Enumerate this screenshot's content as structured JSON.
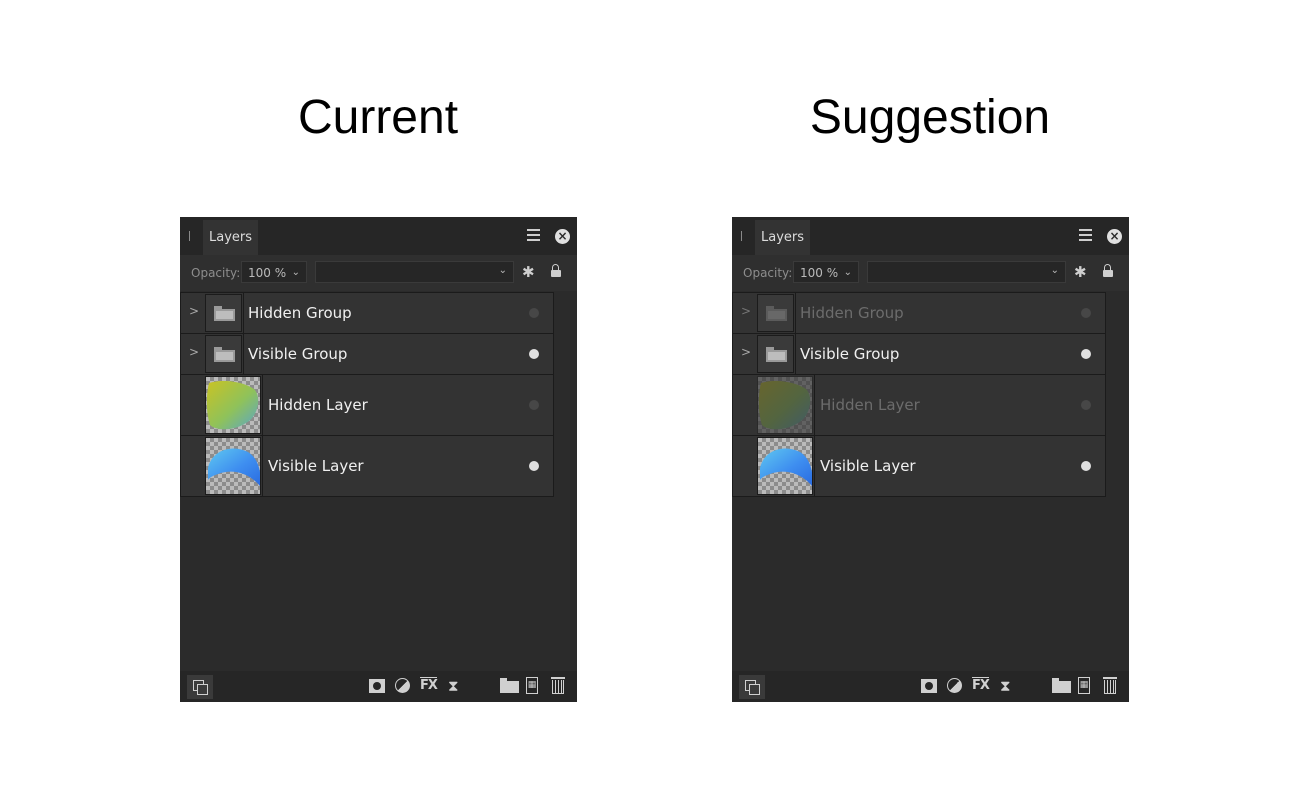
{
  "captions": {
    "left": "Current",
    "right": "Suggestion"
  },
  "panel_common": {
    "tab_label": "Layers",
    "opacity_label": "Opacity:",
    "opacity_value": "100 %",
    "blend_value": ""
  },
  "layers": [
    {
      "name": "Hidden Group",
      "type": "group",
      "visible": false
    },
    {
      "name": "Visible Group",
      "type": "group",
      "visible": true
    },
    {
      "name": "Hidden Layer",
      "type": "pixel",
      "visible": false,
      "gradient": [
        "#c9c324",
        "#8fc25a",
        "#5aa5c9"
      ]
    },
    {
      "name": "Visible Layer",
      "type": "pixel",
      "visible": true,
      "gradient": [
        "#5fc8f0",
        "#3e8ef0",
        "#2a6be0"
      ]
    }
  ],
  "icons": {
    "menu": "hamburger-menu-icon",
    "close": "close-icon",
    "gear": "gear-icon",
    "lock": "lock-icon",
    "expander": "chevron-right-icon",
    "copy": "copy-icon",
    "mask": "mask-icon",
    "adjustment": "adjustment-icon",
    "fx": "fx-icon",
    "live_filter": "hourglass-icon",
    "group": "folder-icon",
    "pixel": "pixel-layer-icon",
    "trash": "trash-icon"
  }
}
